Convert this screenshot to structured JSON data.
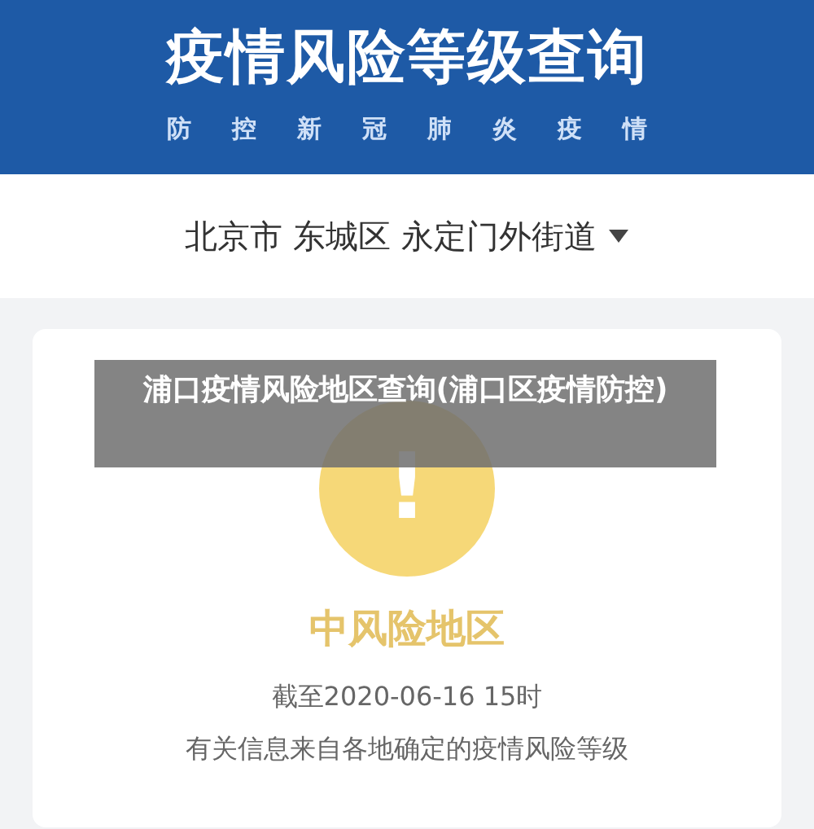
{
  "header": {
    "title": "疫情风险等级查询",
    "subtitle": [
      "防",
      "控",
      "新",
      "冠",
      "肺",
      "炎",
      "疫",
      "情"
    ]
  },
  "location": {
    "parts": [
      "北京市",
      "东城区",
      "永定门外街道"
    ]
  },
  "result": {
    "kind": "medium",
    "icon": "!",
    "label": "中风险地区",
    "as_of": "截至2020-06-16 15时",
    "note": "有关信息来自各地确定的疫情风险等级"
  },
  "overlay_caption": "浦口疫情风险地区查询(浦口区疫情防控)"
}
